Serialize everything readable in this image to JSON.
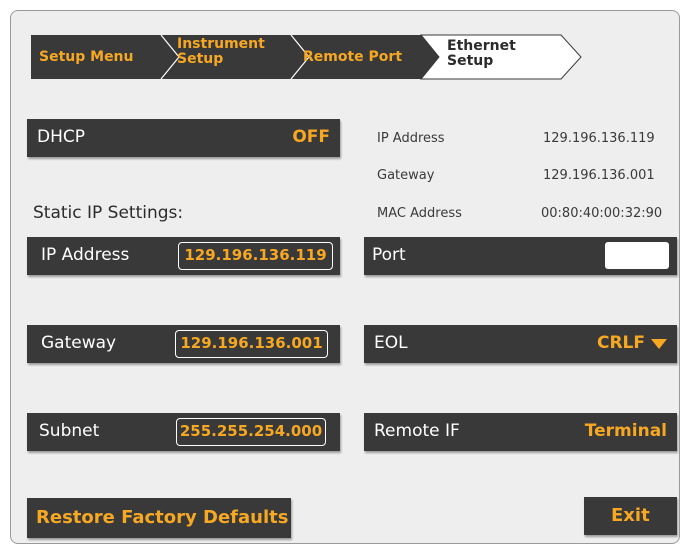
{
  "breadcrumb": {
    "items": [
      {
        "line1": "Setup Menu",
        "line2": ""
      },
      {
        "line1": "Instrument",
        "line2": "Setup"
      },
      {
        "line1": "Remote Port",
        "line2": ""
      },
      {
        "line1": "Ethernet",
        "line2": "Setup"
      }
    ],
    "active_index": 3
  },
  "dhcp": {
    "label": "DHCP",
    "value": "OFF"
  },
  "static_title": "Static IP Settings:",
  "static": {
    "ip": {
      "label": "IP Address",
      "value": "129.196.136.119"
    },
    "gateway": {
      "label": "Gateway",
      "value": "129.196.136.001"
    },
    "subnet": {
      "label": "Subnet",
      "value": "255.255.254.000"
    }
  },
  "info": {
    "ip": {
      "label": "IP Address",
      "value": "129.196.136.119"
    },
    "gateway": {
      "label": "Gateway",
      "value": "129.196.136.001"
    },
    "mac": {
      "label": "MAC Address",
      "value": "00:80:40:00:32:90"
    }
  },
  "port": {
    "label": "Port",
    "value": ""
  },
  "eol": {
    "label": "EOL",
    "value": "CRLF",
    "icon": "caret-down-icon"
  },
  "remote_if": {
    "label": "Remote IF",
    "value": "Terminal"
  },
  "buttons": {
    "restore": "Restore Factory Defaults",
    "exit": "Exit"
  },
  "colors": {
    "accent": "#f7a823",
    "panel": "#393939",
    "background": "#eeeeee"
  }
}
